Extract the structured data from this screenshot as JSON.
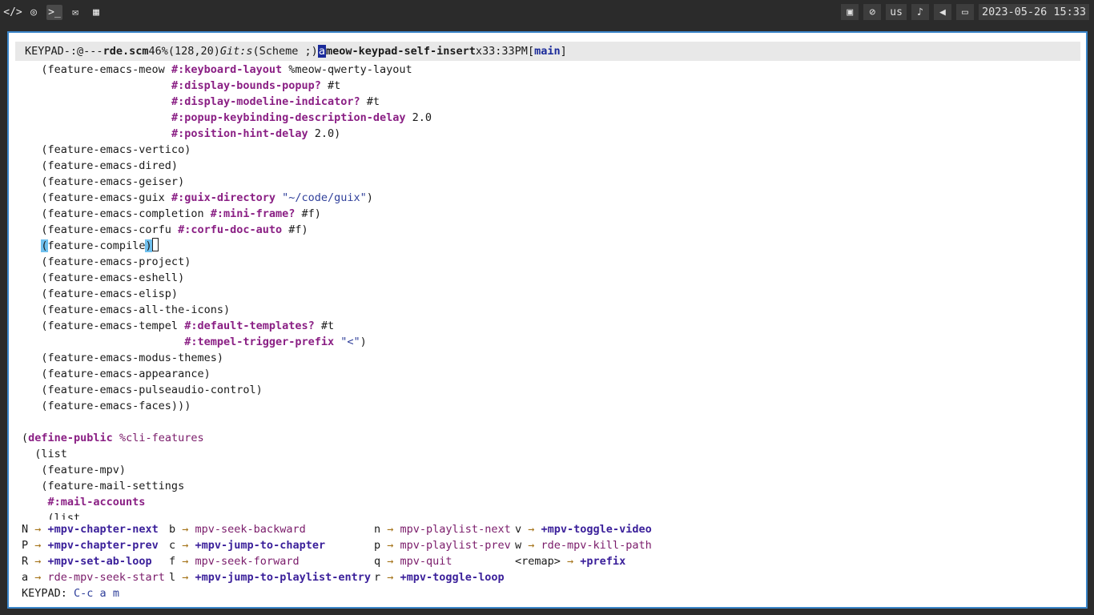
{
  "topbar": {
    "left_icons": [
      "code-icon",
      "chrome-icon",
      "terminal-icon",
      "mail-icon",
      "film-icon"
    ],
    "tray": {
      "layout": "us"
    },
    "clock": "2023-05-26 15:33"
  },
  "modeline": {
    "state": "KEYPAD",
    "flags": "-:",
    "extra": "@---",
    "buffer": "rde.scm",
    "percent": "46%",
    "position": "(128,20)",
    "vcs": "Git:s",
    "mode": "(Scheme ;)",
    "cursor_char": "a",
    "command": "meow-keypad-self-insert",
    "repeat": "x3",
    "time": "3:33PM",
    "branch_open": "[",
    "branch": "main",
    "branch_close": "]"
  },
  "buffer": {
    "lines": [
      [
        {
          "t": "   (feature-emacs-meow "
        },
        {
          "t": "#:keyboard-layout",
          "c": "kw"
        },
        {
          "t": " %meow-qwerty-layout"
        }
      ],
      [
        {
          "t": "                       "
        },
        {
          "t": "#:display-bounds-popup?",
          "c": "kw"
        },
        {
          "t": " #t"
        }
      ],
      [
        {
          "t": "                       "
        },
        {
          "t": "#:display-modeline-indicator?",
          "c": "kw"
        },
        {
          "t": " #t"
        }
      ],
      [
        {
          "t": "                       "
        },
        {
          "t": "#:popup-keybinding-description-delay",
          "c": "kw"
        },
        {
          "t": " 2.0"
        }
      ],
      [
        {
          "t": "                       "
        },
        {
          "t": "#:position-hint-delay",
          "c": "kw"
        },
        {
          "t": " 2.0)"
        }
      ],
      [
        {
          "t": "   (feature-emacs-vertico)"
        }
      ],
      [
        {
          "t": "   (feature-emacs-dired)"
        }
      ],
      [
        {
          "t": "   (feature-emacs-geiser)"
        }
      ],
      [
        {
          "t": "   (feature-emacs-guix "
        },
        {
          "t": "#:guix-directory",
          "c": "kw"
        },
        {
          "t": " "
        },
        {
          "t": "\"~/code/guix\"",
          "c": "str"
        },
        {
          "t": ")"
        }
      ],
      [
        {
          "t": "   (feature-emacs-completion "
        },
        {
          "t": "#:mini-frame?",
          "c": "kw"
        },
        {
          "t": " #f)"
        }
      ],
      [
        {
          "t": "   (feature-emacs-corfu "
        },
        {
          "t": "#:corfu-doc-auto",
          "c": "kw"
        },
        {
          "t": " #f)"
        }
      ],
      [
        {
          "t": "   "
        },
        {
          "t": "(",
          "c": "par-hl"
        },
        {
          "t": "feature-compile"
        },
        {
          "t": ")",
          "c": "par-hl"
        },
        {
          "t": "",
          "c": "cursor"
        }
      ],
      [
        {
          "t": "   (feature-emacs-project)"
        }
      ],
      [
        {
          "t": "   (feature-emacs-eshell)"
        }
      ],
      [
        {
          "t": "   (feature-emacs-elisp)"
        }
      ],
      [
        {
          "t": "   (feature-emacs-all-the-icons)"
        }
      ],
      [
        {
          "t": "   (feature-emacs-tempel "
        },
        {
          "t": "#:default-templates?",
          "c": "kw"
        },
        {
          "t": " #t"
        }
      ],
      [
        {
          "t": "                         "
        },
        {
          "t": "#:tempel-trigger-prefix",
          "c": "kw"
        },
        {
          "t": " "
        },
        {
          "t": "\"<\"",
          "c": "str"
        },
        {
          "t": ")"
        }
      ],
      [
        {
          "t": "   (feature-emacs-modus-themes)"
        }
      ],
      [
        {
          "t": "   (feature-emacs-appearance)"
        }
      ],
      [
        {
          "t": "   (feature-emacs-pulseaudio-control)"
        }
      ],
      [
        {
          "t": "   (feature-emacs-faces)))"
        }
      ],
      [
        {
          "t": ""
        }
      ],
      [
        {
          "t": "("
        },
        {
          "t": "define-public",
          "c": "kw"
        },
        {
          "t": " "
        },
        {
          "t": "%cli-features",
          "c": "var"
        }
      ],
      [
        {
          "t": "  (list"
        }
      ],
      [
        {
          "t": "   (feature-mpv)"
        }
      ],
      [
        {
          "t": "   (feature-mail-settings"
        }
      ],
      [
        {
          "t": "    "
        },
        {
          "t": "#:mail-accounts",
          "c": "kw"
        }
      ],
      [
        {
          "t": "    (list"
        }
      ]
    ]
  },
  "keyhints": [
    {
      "key": "N",
      "cmd": "+mpv-chapter-next",
      "bold": true
    },
    {
      "key": "P",
      "cmd": "+mpv-chapter-prev",
      "bold": true
    },
    {
      "key": "R",
      "cmd": "+mpv-set-ab-loop",
      "bold": true
    },
    {
      "key": "a",
      "cmd": "rde-mpv-seek-start",
      "bold": false
    },
    {
      "key": "b",
      "cmd": "mpv-seek-backward",
      "bold": false
    },
    {
      "key": "c",
      "cmd": "+mpv-jump-to-chapter",
      "bold": true
    },
    {
      "key": "f",
      "cmd": "mpv-seek-forward",
      "bold": false
    },
    {
      "key": "l",
      "cmd": "+mpv-jump-to-playlist-entry",
      "bold": true
    },
    {
      "key": "n",
      "cmd": "mpv-playlist-next",
      "bold": false
    },
    {
      "key": "p",
      "cmd": "mpv-playlist-prev",
      "bold": false
    },
    {
      "key": "q",
      "cmd": "mpv-quit",
      "bold": false
    },
    {
      "key": "r",
      "cmd": "+mpv-toggle-loop",
      "bold": true
    },
    {
      "key": "v",
      "cmd": "+mpv-toggle-video",
      "bold": true
    },
    {
      "key": "w",
      "cmd": "rde-mpv-kill-path",
      "bold": false
    },
    {
      "key": "<remap>",
      "cmd": "+prefix",
      "bold": true
    }
  ],
  "echo": {
    "label": "KEYPAD:",
    "keys": "C-c a m"
  }
}
